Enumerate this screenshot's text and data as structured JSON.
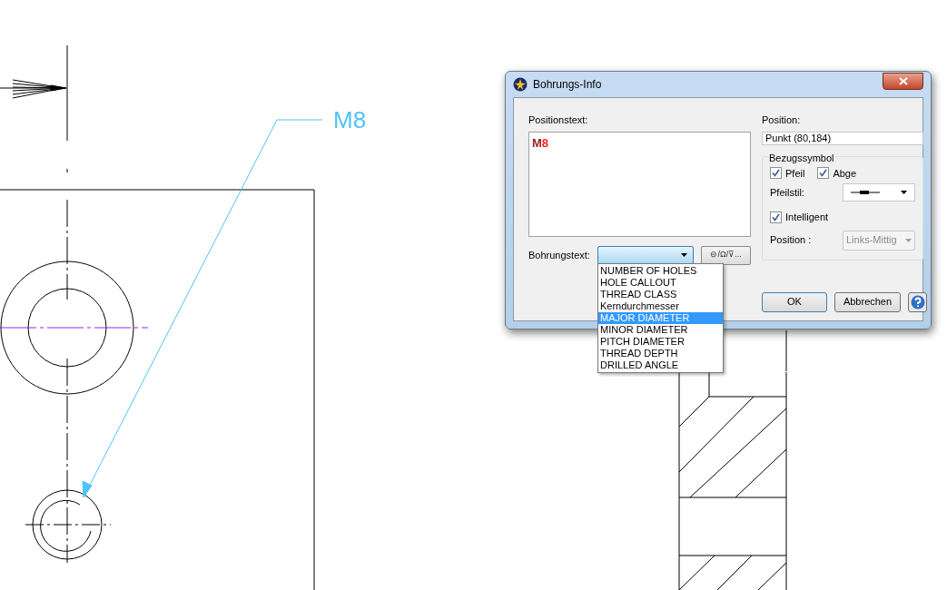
{
  "drawing": {
    "callout_label": "M8"
  },
  "dialog": {
    "title": "Bohrungs-Info",
    "position_text": {
      "label": "Positionstext:",
      "segments": [
        {
          "text": "M",
          "color": "#9b1c1c"
        },
        {
          "text": "8",
          "color": "#ff2020"
        }
      ]
    },
    "position": {
      "label": "Position:",
      "value": "Punkt (80,184)"
    },
    "reference_symbol": {
      "title": "Bezugssymbol",
      "checkboxes": [
        {
          "label": "Pfeil",
          "checked": true
        },
        {
          "label": "Abge",
          "checked": true
        }
      ],
      "arrow_style_label": "Pfeilstil:",
      "intelligent": {
        "label": "Intelligent",
        "checked": true
      },
      "position_label": "Position :",
      "position_value": "Links-Mittig",
      "position_disabled": true
    },
    "hole_text": {
      "label": "Bohrungstext:",
      "symbol_button": "⊖/Ω/⊽...",
      "open": true,
      "options": [
        {
          "label": "NUMBER OF HOLES",
          "selected": false
        },
        {
          "label": "HOLE CALLOUT",
          "selected": false
        },
        {
          "label": "THREAD CLASS",
          "selected": false
        },
        {
          "label": "Kerndurchmesser",
          "selected": false
        },
        {
          "label": "MAJOR DIAMETER",
          "selected": true
        },
        {
          "label": "MINOR DIAMETER",
          "selected": false
        },
        {
          "label": "PITCH DIAMETER",
          "selected": false
        },
        {
          "label": "THREAD DEPTH",
          "selected": false
        },
        {
          "label": "DRILLED ANGLE",
          "selected": false
        }
      ]
    },
    "buttons": [
      "OK",
      "Abbrechen"
    ]
  }
}
